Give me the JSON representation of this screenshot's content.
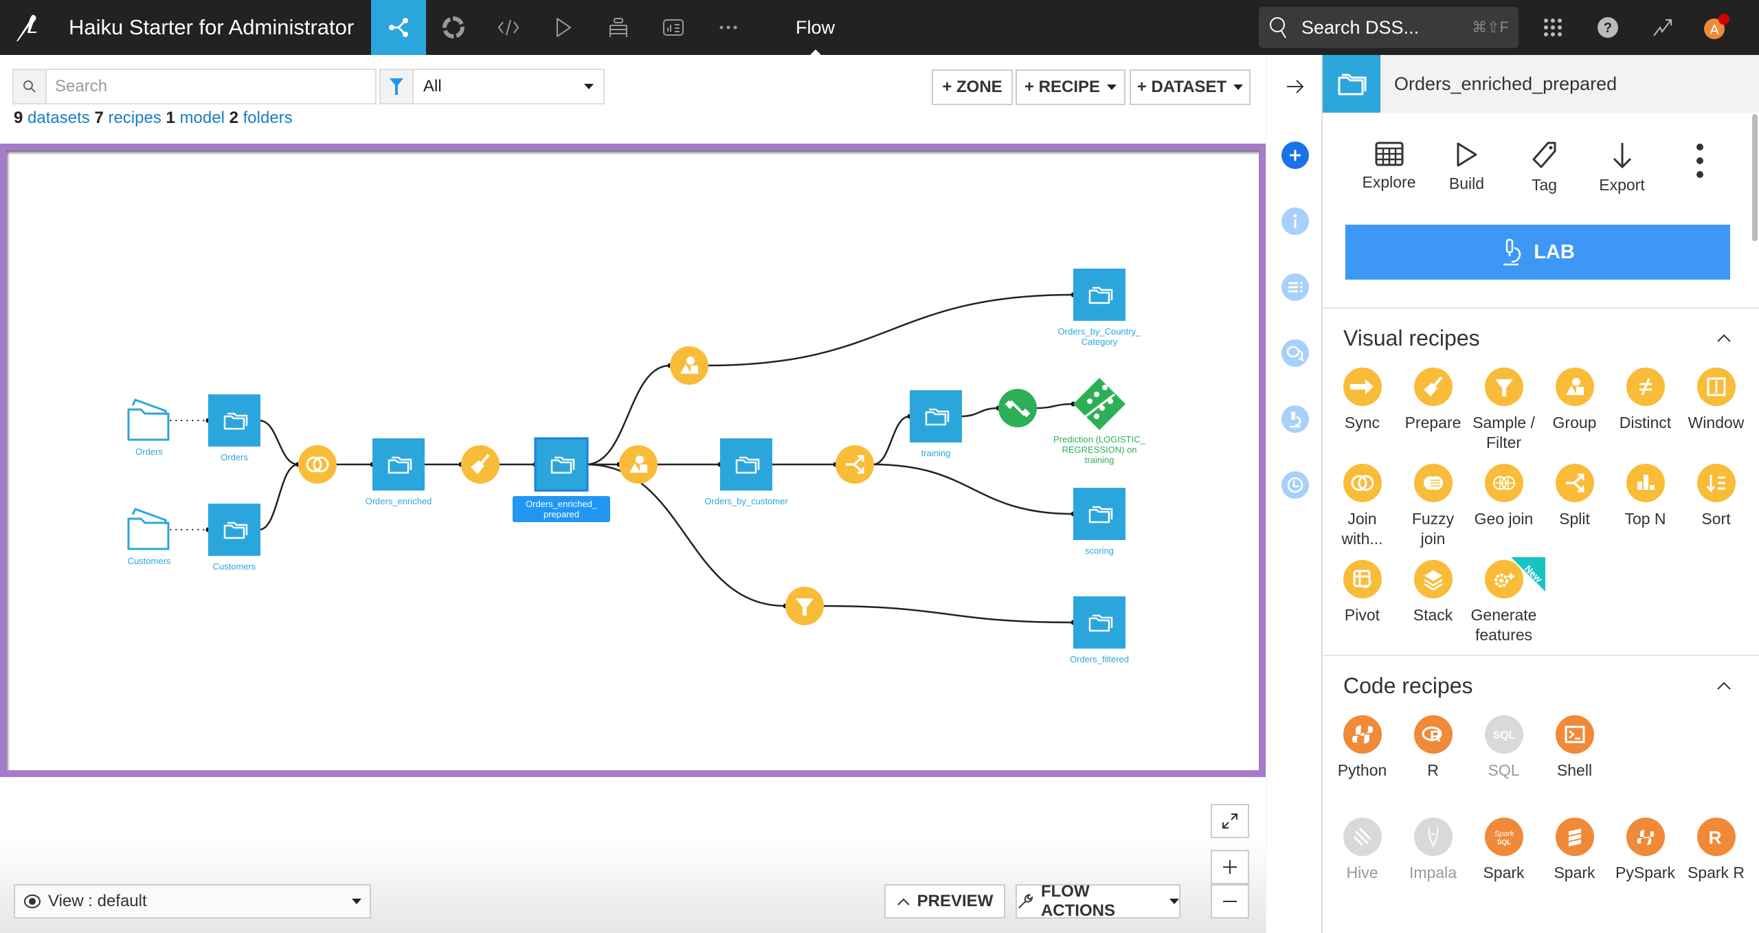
{
  "topbar": {
    "project_title": "Haiku Starter for Administrator",
    "nav_items": [
      {
        "name": "flow",
        "icon": "flow-icon",
        "active": true
      },
      {
        "name": "lab",
        "icon": "lifebuoy-icon"
      },
      {
        "name": "code",
        "icon": "code-icon"
      },
      {
        "name": "jobs",
        "icon": "play-icon"
      },
      {
        "name": "wiki",
        "icon": "stack-icon"
      },
      {
        "name": "dashboards",
        "icon": "dashboard-icon"
      },
      {
        "name": "more",
        "icon": "ellipsis-icon"
      }
    ],
    "current_section": "Flow",
    "search_label": "Search DSS...",
    "search_shortcut": "⌘⇧F",
    "avatar_letter": "A"
  },
  "toolbar": {
    "search_placeholder": "Search",
    "filter_value": "All",
    "counts": [
      {
        "n": "9",
        "label": "datasets"
      },
      {
        "n": "7",
        "label": "recipes"
      },
      {
        "n": "1",
        "label": "model"
      },
      {
        "n": "2",
        "label": "folders"
      }
    ],
    "zone_label": "+ ZONE",
    "recipe_label": "+ RECIPE",
    "dataset_label": "+ DATASET"
  },
  "flow": {
    "nodes": [
      {
        "id": "orders_folder",
        "type": "folder",
        "label": "Orders"
      },
      {
        "id": "orders_ds",
        "type": "dataset",
        "label": "Orders"
      },
      {
        "id": "customers_folder",
        "type": "folder",
        "label": "Customers"
      },
      {
        "id": "customers_ds",
        "type": "dataset",
        "label": "Customers"
      },
      {
        "id": "join",
        "type": "recipe",
        "recipe": "join"
      },
      {
        "id": "orders_enriched",
        "type": "dataset",
        "label": "Orders_enriched"
      },
      {
        "id": "prepare",
        "type": "recipe",
        "recipe": "prepare"
      },
      {
        "id": "orders_enriched_prepared",
        "type": "dataset",
        "label": "Orders_enriched_\nprepared",
        "selected": true
      },
      {
        "id": "group_top",
        "type": "recipe",
        "recipe": "group"
      },
      {
        "id": "group_mid",
        "type": "recipe",
        "recipe": "group"
      },
      {
        "id": "orders_by_customer",
        "type": "dataset",
        "label": "Orders_by_customer"
      },
      {
        "id": "split",
        "type": "recipe",
        "recipe": "split"
      },
      {
        "id": "training",
        "type": "dataset",
        "label": "training"
      },
      {
        "id": "train",
        "type": "recipe",
        "recipe": "train"
      },
      {
        "id": "model",
        "type": "model",
        "label": "Prediction (LOGISTIC_\nREGRESSION) on\ntraining"
      },
      {
        "id": "orders_by_country",
        "type": "dataset",
        "label": "Orders_by_Country_\nCategory"
      },
      {
        "id": "scoring",
        "type": "dataset",
        "label": "scoring"
      },
      {
        "id": "filter",
        "type": "recipe",
        "recipe": "filter"
      },
      {
        "id": "orders_filtered",
        "type": "dataset",
        "label": "Orders_filtered"
      }
    ],
    "edges": [
      [
        "orders_folder",
        "orders_ds",
        "dotted"
      ],
      [
        "customers_folder",
        "customers_ds",
        "dotted"
      ],
      [
        "orders_ds",
        "join"
      ],
      [
        "customers_ds",
        "join"
      ],
      [
        "join",
        "orders_enriched"
      ],
      [
        "orders_enriched",
        "prepare"
      ],
      [
        "prepare",
        "orders_enriched_prepared"
      ],
      [
        "orders_enriched_prepared",
        "group_top"
      ],
      [
        "orders_enriched_prepared",
        "group_mid"
      ],
      [
        "orders_enriched_prepared",
        "filter"
      ],
      [
        "group_top",
        "orders_by_country"
      ],
      [
        "group_mid",
        "orders_by_customer"
      ],
      [
        "orders_by_customer",
        "split"
      ],
      [
        "split",
        "training"
      ],
      [
        "split",
        "scoring"
      ],
      [
        "training",
        "train"
      ],
      [
        "train",
        "model"
      ],
      [
        "filter",
        "orders_filtered"
      ]
    ]
  },
  "bottom": {
    "view_label": "View : default",
    "preview_label": "PREVIEW",
    "flow_actions_label": "FLOW ACTIONS"
  },
  "rail": {
    "items": [
      "add",
      "info",
      "details",
      "discussions",
      "lab",
      "timeline"
    ]
  },
  "panel": {
    "title": "Orders_enriched_prepared",
    "actions": [
      {
        "label": "Explore",
        "icon": "table-icon"
      },
      {
        "label": "Build",
        "icon": "play-icon"
      },
      {
        "label": "Tag",
        "icon": "tag-icon"
      },
      {
        "label": "Export",
        "icon": "download-icon"
      }
    ],
    "lab_label": "LAB",
    "visual_recipes_title": "Visual recipes",
    "visual_recipes": [
      {
        "label": "Sync",
        "icon": "sync"
      },
      {
        "label": "Prepare",
        "icon": "prepare"
      },
      {
        "label": "Sample / Filter",
        "icon": "filter"
      },
      {
        "label": "Group",
        "icon": "group"
      },
      {
        "label": "Distinct",
        "icon": "distinct"
      },
      {
        "label": "Window",
        "icon": "window"
      },
      {
        "label": "Join with...",
        "icon": "join"
      },
      {
        "label": "Fuzzy join",
        "icon": "fuzzy"
      },
      {
        "label": "Geo join",
        "icon": "geo"
      },
      {
        "label": "Split",
        "icon": "split"
      },
      {
        "label": "Top N",
        "icon": "topn"
      },
      {
        "label": "Sort",
        "icon": "sort"
      },
      {
        "label": "Pivot",
        "icon": "pivot"
      },
      {
        "label": "Stack",
        "icon": "stack"
      },
      {
        "label": "Generate features",
        "icon": "generate",
        "badge": "New"
      }
    ],
    "code_recipes_title": "Code recipes",
    "code_recipes": [
      {
        "label": "Python",
        "icon": "python"
      },
      {
        "label": "R",
        "icon": "r"
      },
      {
        "label": "SQL",
        "icon": "sql",
        "disabled": true
      },
      {
        "label": "Shell",
        "icon": "shell"
      },
      {
        "label": "",
        "icon": ""
      },
      {
        "label": "",
        "icon": ""
      },
      {
        "label": "Hive",
        "icon": "hive",
        "disabled": true
      },
      {
        "label": "Impala",
        "icon": "impala",
        "disabled": true
      },
      {
        "label": "Spark",
        "icon": "sparksql"
      },
      {
        "label": "Spark",
        "icon": "scala"
      },
      {
        "label": "PySpark",
        "icon": "pyspark"
      },
      {
        "label": "Spark R",
        "icon": "sparkr"
      }
    ]
  },
  "colors": {
    "dataset": "#2aa6dc",
    "recipe_visual": "#f9bc39",
    "recipe_code": "#f08a38",
    "model": "#2eaf57",
    "zone_border": "#a67bc7",
    "topbar": "#222222",
    "lab_button": "#3d98f5",
    "selected_label": "#2196f3",
    "disabled": "#d9d9d9",
    "new_badge": "#17c4c4",
    "notification": "#d40000",
    "avatar": "#f08a38"
  }
}
